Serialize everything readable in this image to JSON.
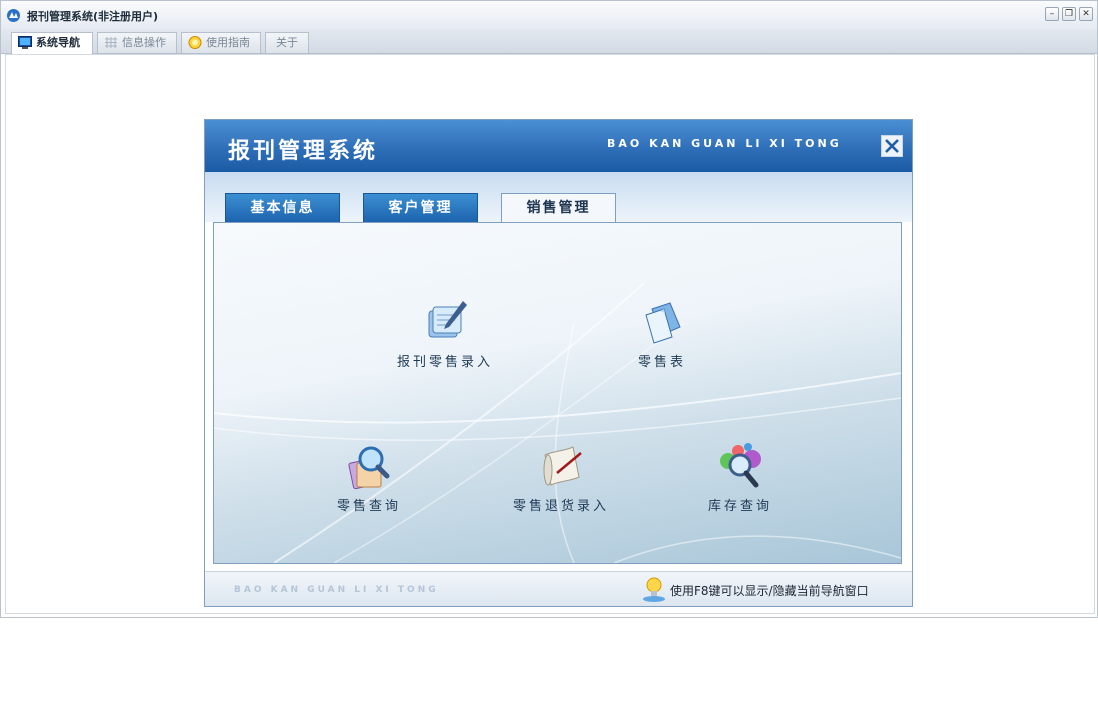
{
  "window": {
    "title": "报刊管理系统(非注册用户)"
  },
  "app_tabs": [
    {
      "label": "系统导航",
      "icon": "monitor-icon",
      "active": true
    },
    {
      "label": "信息操作",
      "icon": "grid-icon",
      "active": false
    },
    {
      "label": "使用指南",
      "icon": "help-icon",
      "active": false
    },
    {
      "label": "关于",
      "icon": "",
      "active": false
    }
  ],
  "panel": {
    "title": "报刊管理系统",
    "subtitle": "BAO KAN GUAN LI XI TONG",
    "tabs": [
      {
        "label": "基本信息",
        "active": false
      },
      {
        "label": "客户管理",
        "active": false
      },
      {
        "label": "销售管理",
        "active": true
      }
    ],
    "functions": [
      {
        "label": "报刊零售录入",
        "icon": "edit-document-icon"
      },
      {
        "label": "零售表",
        "icon": "document-icon"
      },
      {
        "label": "零售查询",
        "icon": "search-document-icon"
      },
      {
        "label": "零售退货录入",
        "icon": "scroll-quill-icon"
      },
      {
        "label": "库存查询",
        "icon": "magnifier-spheres-icon"
      }
    ],
    "footer": {
      "subtitle": "BAO KAN GUAN LI XI TONG",
      "tip": "使用F8键可以显示/隐藏当前导航窗口"
    }
  },
  "colors": {
    "header_blue": "#2f6fb8",
    "tab_blue": "#1c62ad",
    "body_gradient_end": "#a8c6d8"
  }
}
